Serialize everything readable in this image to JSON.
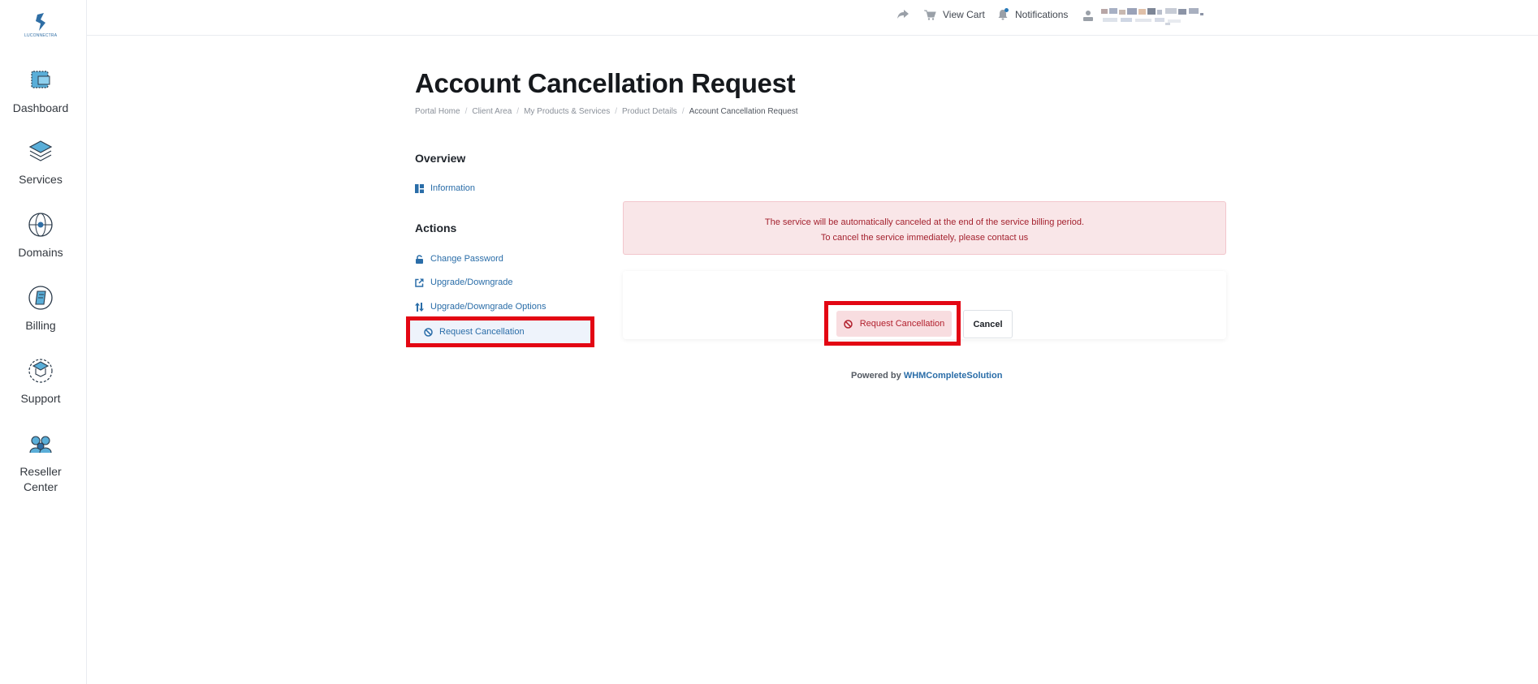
{
  "logo": {
    "text": "LUCONNECTRA"
  },
  "sidebar": {
    "items": [
      {
        "label": "Dashboard"
      },
      {
        "label": "Services"
      },
      {
        "label": "Domains"
      },
      {
        "label": "Billing"
      },
      {
        "label": "Support"
      },
      {
        "label": "Reseller",
        "label2": "Center"
      }
    ]
  },
  "topbar": {
    "view_cart": "View Cart",
    "notifications": "Notifications"
  },
  "page": {
    "title": "Account Cancellation Request",
    "breadcrumb": [
      "Portal Home",
      "Client Area",
      "My Products & Services",
      "Product Details",
      "Account Cancellation Request"
    ]
  },
  "side": {
    "overview_heading": "Overview",
    "information": "Information",
    "actions_heading": "Actions",
    "change_password": "Change Password",
    "upgrade_downgrade": "Upgrade/Downgrade",
    "upgrade_downgrade_options": "Upgrade/Downgrade Options",
    "request_cancellation": "Request Cancellation"
  },
  "alert": {
    "line1": "The service will be automatically canceled at the end of the service billing period.",
    "line2": "To cancel the service immediately, please contact us"
  },
  "form": {
    "submit_label": "Request Cancellation",
    "cancel_label": "Cancel"
  },
  "footer": {
    "powered_by": "Powered by",
    "brand": "WHMCompleteSolution"
  },
  "colors": {
    "accent": "#2a6da8",
    "danger_text": "#b11f2c",
    "alert_bg": "#f9e6e8",
    "highlight": "#e30613"
  }
}
